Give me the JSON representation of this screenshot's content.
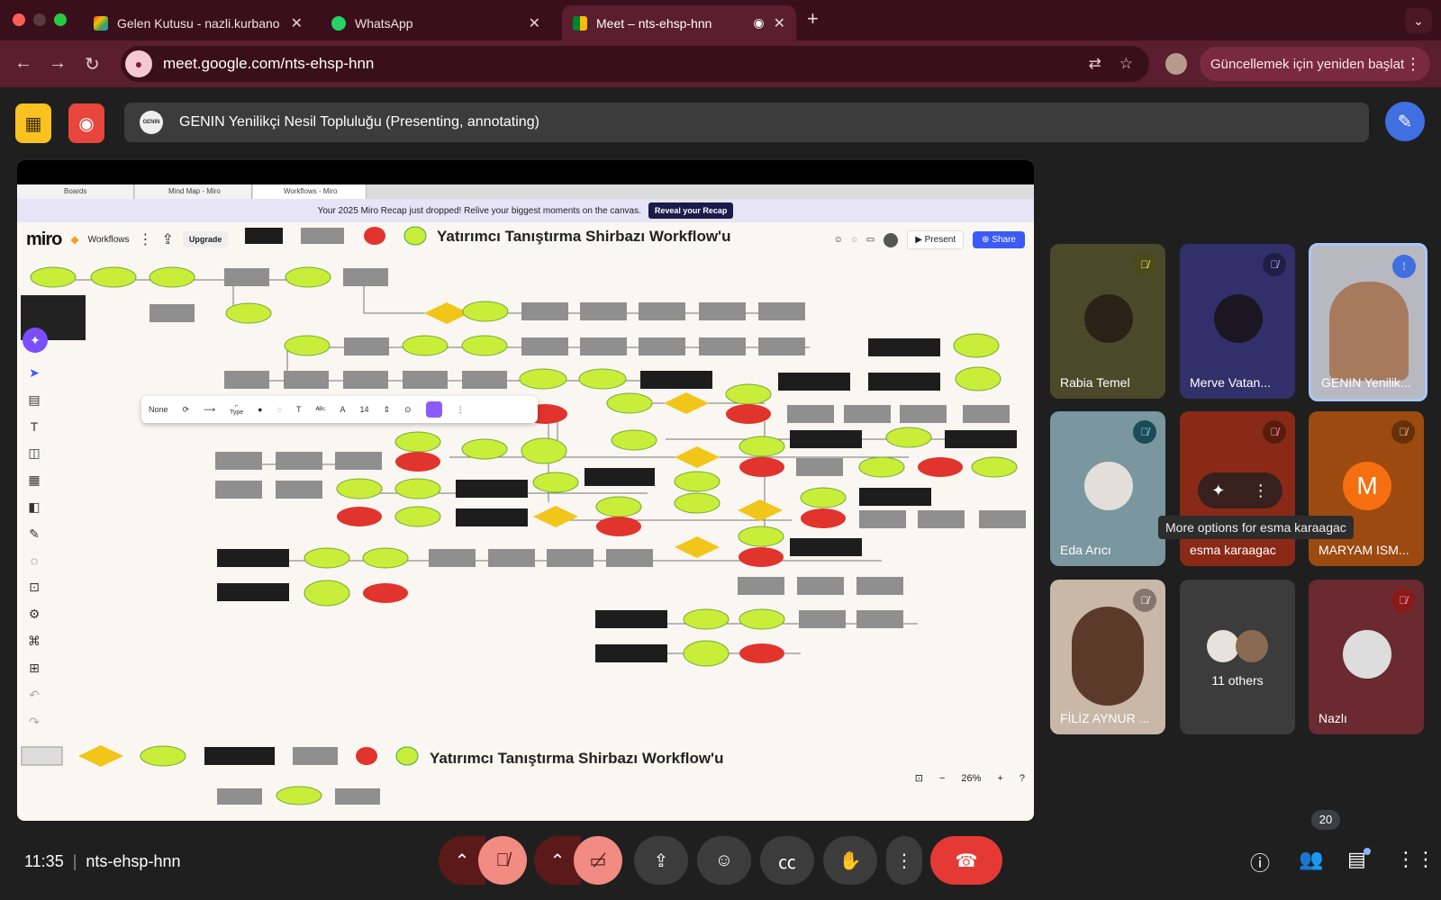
{
  "browser": {
    "tabs": [
      {
        "title": "Gelen Kutusu - nazli.kurbano",
        "icon": "gmail-icon"
      },
      {
        "title": "WhatsApp",
        "icon": "whatsapp-icon"
      },
      {
        "title": "Meet – nts-ehsp-hnn",
        "icon": "meet-icon",
        "active": true
      }
    ],
    "url": "meet.google.com/nts-ehsp-hnn",
    "update_label": "Güncellemek için yeniden başlat"
  },
  "meet": {
    "presenter_label": "GENIN Yenilikçi Nesil Topluluğu (Presenting, annotating)",
    "presenter_avatar": "GENIN",
    "time": "11:35",
    "meeting_code": "nts-ehsp-hnn",
    "participant_count": "20",
    "tooltip": "More options for esma karaagac",
    "participants": [
      {
        "name": "Rabia Temel"
      },
      {
        "name": "Merve Vatan..."
      },
      {
        "name": "GENIN Yenilik..."
      },
      {
        "name": "Eda Arıcı"
      },
      {
        "name": "esma karaagac"
      },
      {
        "name": "MARYAM ISM...",
        "initial": "M"
      },
      {
        "name": "FİLİZ AYNUR ..."
      },
      {
        "name": "11 others"
      },
      {
        "name": "Nazlı"
      }
    ]
  },
  "miro": {
    "tabs": [
      "Boards",
      "Mind Map - Miro",
      "Workflows - Miro"
    ],
    "banner_text": "Your 2025 Miro Recap just dropped! Relive your biggest moments on the canvas.",
    "banner_button": "Reveal your Recap",
    "logo": "miro",
    "board_name": "Workflows",
    "upgrade": "Upgrade",
    "present": "Present",
    "share": "Share",
    "title": "Yatırımcı Tanıştırma Shirbazı Workflow'u",
    "ctx_none": "None",
    "ctx_size": "14",
    "ctx_type": "Type",
    "zoom": "26%"
  },
  "colors": {
    "tab_bg": "#3a0f1c",
    "nav_bg": "#5a1e2e",
    "meet_bg": "#1f1f1f",
    "end_call": "#e53935",
    "flow_green": "#c8ee3a",
    "flow_red": "#e0342c",
    "flow_yellow": "#f2c51a",
    "flow_gray": "#8f8f8f",
    "flow_black": "#1d1d1d"
  }
}
